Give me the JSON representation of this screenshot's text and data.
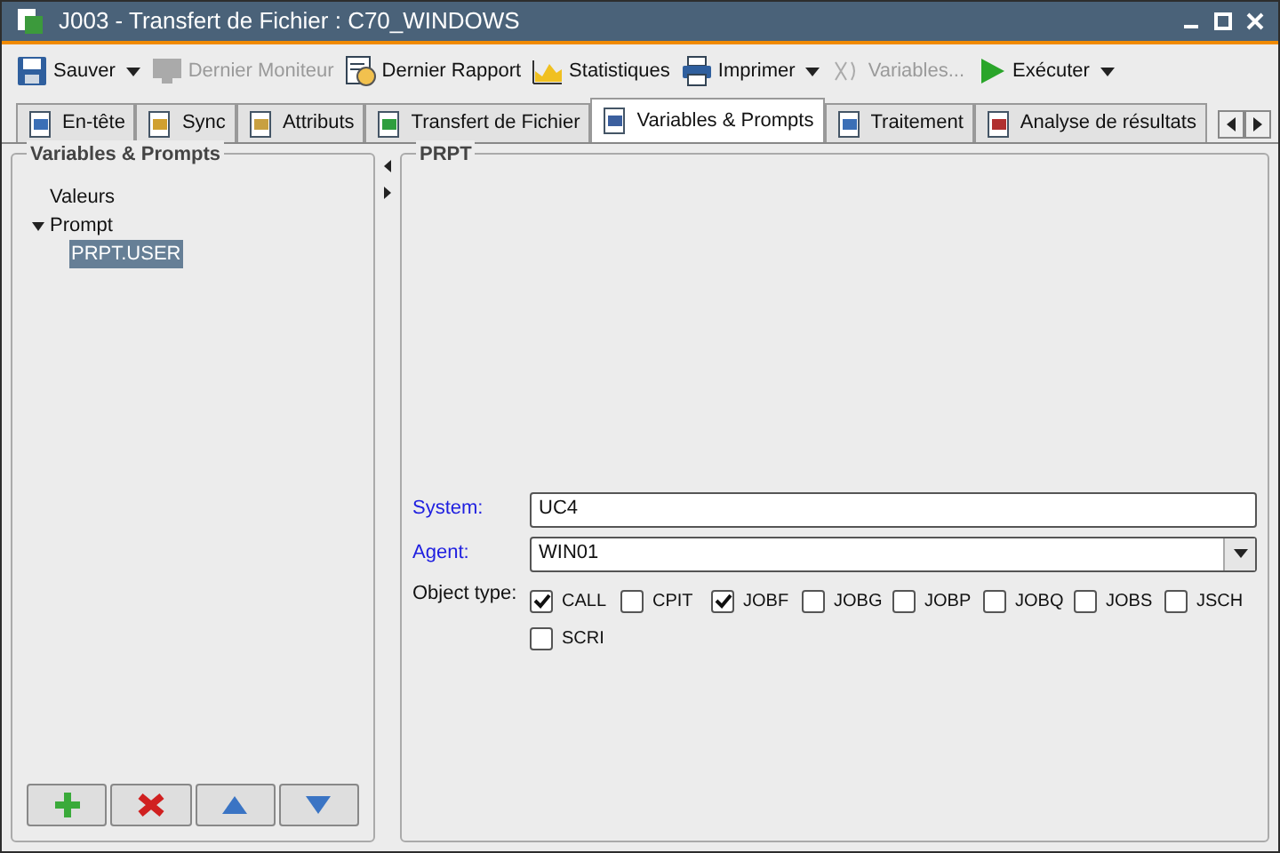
{
  "window": {
    "title": "J003 - Transfert de Fichier : C70_WINDOWS"
  },
  "toolbar": [
    {
      "label": "Sauver",
      "disabled": false,
      "dropdown": true
    },
    {
      "label": "Dernier Moniteur",
      "disabled": true,
      "dropdown": false
    },
    {
      "label": "Dernier Rapport",
      "disabled": false,
      "dropdown": false
    },
    {
      "label": "Statistiques",
      "disabled": false,
      "dropdown": false
    },
    {
      "label": "Imprimer",
      "disabled": false,
      "dropdown": true
    },
    {
      "label": "Variables...",
      "disabled": true,
      "dropdown": false
    },
    {
      "label": "Exécuter",
      "disabled": false,
      "dropdown": true
    }
  ],
  "tabs": [
    {
      "label": "En-tête",
      "selected": false
    },
    {
      "label": "Sync",
      "selected": false
    },
    {
      "label": "Attributs",
      "selected": false
    },
    {
      "label": "Transfert de Fichier",
      "selected": false
    },
    {
      "label": "Variables & Prompts",
      "selected": true
    },
    {
      "label": "Traitement",
      "selected": false
    },
    {
      "label": "Analyse de résultats",
      "selected": false
    }
  ],
  "left_panel": {
    "title": "Variables & Prompts",
    "tree": [
      {
        "label": "Valeurs",
        "selected": false
      },
      {
        "label": "Prompt",
        "selected": false,
        "expanded": true,
        "children": [
          {
            "label": "PRPT.USER",
            "selected": true
          }
        ]
      }
    ]
  },
  "right_panel": {
    "title": "PRPT",
    "system": {
      "label": "System:",
      "value": "UC4"
    },
    "agent": {
      "label": "Agent:",
      "value": "WIN01"
    },
    "object_type": {
      "label": "Object type:",
      "options": [
        {
          "label": "CALL",
          "checked": true
        },
        {
          "label": "CPIT",
          "checked": false
        },
        {
          "label": "JOBF",
          "checked": true
        },
        {
          "label": "JOBG",
          "checked": false
        },
        {
          "label": "JOBP",
          "checked": false
        },
        {
          "label": "JOBQ",
          "checked": false
        },
        {
          "label": "JOBS",
          "checked": false
        },
        {
          "label": "JSCH",
          "checked": false
        },
        {
          "label": "SCRI",
          "checked": false
        }
      ]
    }
  }
}
